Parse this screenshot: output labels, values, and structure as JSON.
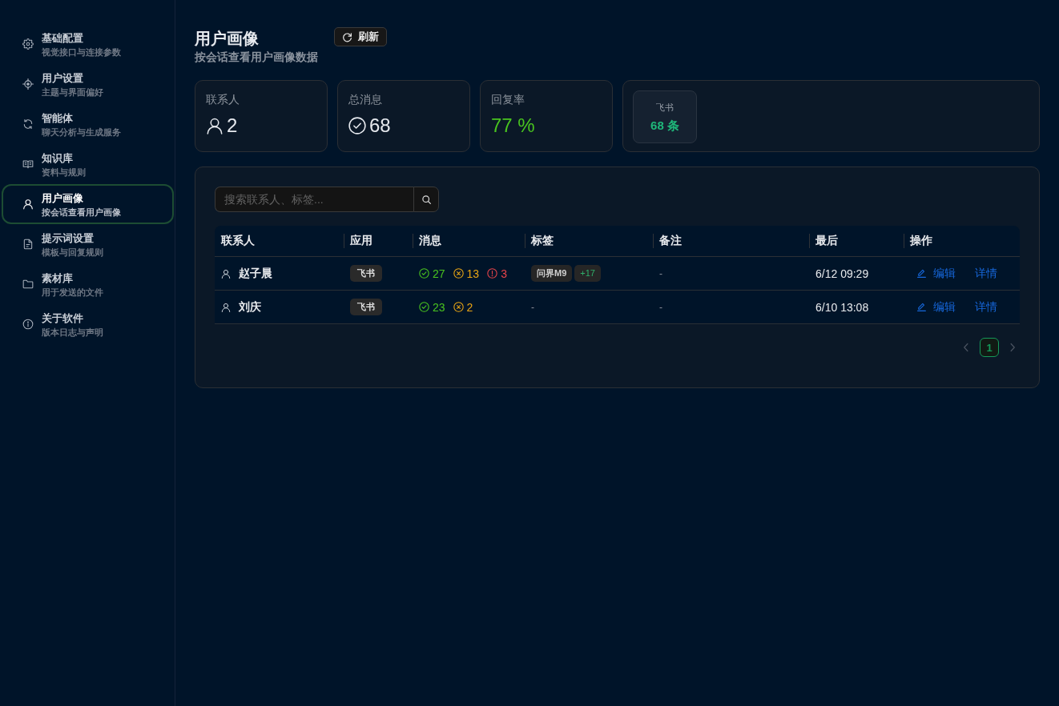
{
  "sidebar": {
    "items": [
      {
        "title": "基础配置",
        "subtitle": "视觉接口与连接参数",
        "selected": false
      },
      {
        "title": "用户设置",
        "subtitle": "主题与界面偏好",
        "selected": false
      },
      {
        "title": "智能体",
        "subtitle": "聊天分析与生成服务",
        "selected": false
      },
      {
        "title": "知识库",
        "subtitle": "资料与规则",
        "selected": false
      },
      {
        "title": "用户画像",
        "subtitle": "按会话查看用户画像",
        "selected": true
      },
      {
        "title": "提示词设置",
        "subtitle": "模板与回复规则",
        "selected": false
      },
      {
        "title": "素材库",
        "subtitle": "用于发送的文件",
        "selected": false
      },
      {
        "title": "关于软件",
        "subtitle": "版本日志与声明",
        "selected": false
      }
    ]
  },
  "header": {
    "title": "用户画像",
    "subtitle": "按会话查看用户画像数据",
    "refresh_button": "刷新"
  },
  "stats": [
    {
      "label": "联系人",
      "value": "2",
      "kind": "contacts"
    },
    {
      "label": "总消息",
      "value": "68",
      "kind": "messages"
    },
    {
      "label": "回复率",
      "value": "77 %",
      "kind": "rate"
    }
  ],
  "apps": [
    {
      "name": "飞书",
      "count": "68 条"
    }
  ],
  "search": {
    "placeholder": "搜索联系人、标签..."
  },
  "table": {
    "columns": [
      "联系人",
      "应用",
      "消息",
      "标签",
      "备注",
      "最后",
      "操作"
    ],
    "rows": [
      {
        "contact": "赵子晨",
        "app": "飞书",
        "messages": [
          {
            "kind": "ok",
            "count": "27"
          },
          {
            "kind": "pending",
            "count": "13"
          },
          {
            "kind": "error",
            "count": "3"
          }
        ],
        "tags": [
          {
            "kind": "tag",
            "label": "问界M9"
          },
          {
            "kind": "more",
            "label": "+17"
          }
        ],
        "note": "-",
        "last": "6/12 09:29",
        "actions": {
          "edit": "编辑",
          "details": "详情"
        }
      },
      {
        "contact": "刘庆",
        "app": "飞书",
        "messages": [
          {
            "kind": "ok",
            "count": "23"
          },
          {
            "kind": "pending",
            "count": "2"
          }
        ],
        "tags": [
          {
            "kind": "none",
            "label": "-"
          }
        ],
        "note": "-",
        "last": "6/10 13:08",
        "actions": {
          "edit": "编辑",
          "details": "详情"
        }
      }
    ]
  },
  "pagination": {
    "pages": [
      {
        "label": "1",
        "selected": true
      }
    ]
  }
}
